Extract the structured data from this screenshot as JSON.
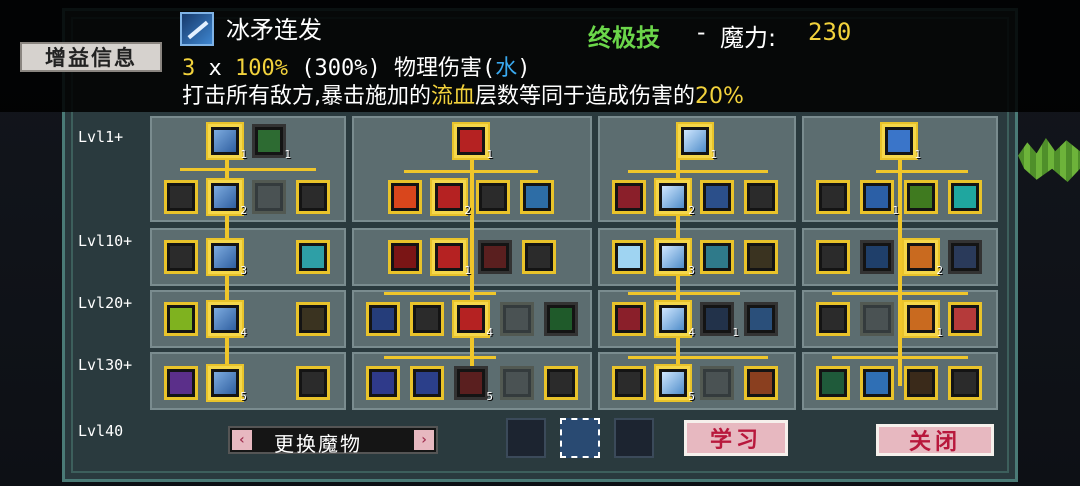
{
  "buff_button": "增益信息",
  "skill": {
    "name": "冰矛连发",
    "type_label": "终极技",
    "separator": "-",
    "mana_label": "魔力:",
    "mana_value": "230",
    "hits": "3",
    "times": "x",
    "percent": "100%",
    "paren_percent": "(300%)",
    "damage_type": "物理伤害(",
    "element": "水",
    "damage_close": ")",
    "desc_part1": "打击所有敌方,暴击施加的",
    "desc_highlight": "流血",
    "desc_part2": "层数等同于造成伤害的",
    "desc_percent": "20%"
  },
  "rows": [
    "Lvl1+",
    "Lvl10+",
    "Lvl20+",
    "Lvl30+",
    "Lvl40"
  ],
  "swap_label": "更换魔物",
  "learn_label": "学习",
  "close_label": "关闭",
  "accent": "#e9c32a",
  "nodes": [
    {
      "id": "n1",
      "lvl": "1"
    },
    {
      "id": "n2",
      "lvl": "1"
    },
    {
      "id": "n3",
      "lvl": "2"
    },
    {
      "id": "n4",
      "lvl": ""
    },
    {
      "id": "n5",
      "lvl": "1"
    },
    {
      "id": "n6",
      "lvl": "2"
    },
    {
      "id": "n7",
      "lvl": "3"
    },
    {
      "id": "n8",
      "lvl": "1"
    },
    {
      "id": "n9",
      "lvl": "1"
    },
    {
      "id": "n10",
      "lvl": "2"
    },
    {
      "id": "n11",
      "lvl": "1"
    },
    {
      "id": "n12",
      "lvl": "3"
    },
    {
      "id": "n13",
      "lvl": "4"
    },
    {
      "id": "n14",
      "lvl": "4"
    },
    {
      "id": "n15",
      "lvl": "5"
    },
    {
      "id": "n16",
      "lvl": "5"
    },
    {
      "id": "n17",
      "lvl": "1"
    },
    {
      "id": "n18",
      "lvl": "1"
    },
    {
      "id": "n19",
      "lvl": "1"
    },
    {
      "id": "n20",
      "lvl": "2"
    },
    {
      "id": "n21",
      "lvl": "5"
    },
    {
      "id": "n22",
      "lvl": "4"
    },
    {
      "id": "n23",
      "lvl": "1"
    }
  ]
}
